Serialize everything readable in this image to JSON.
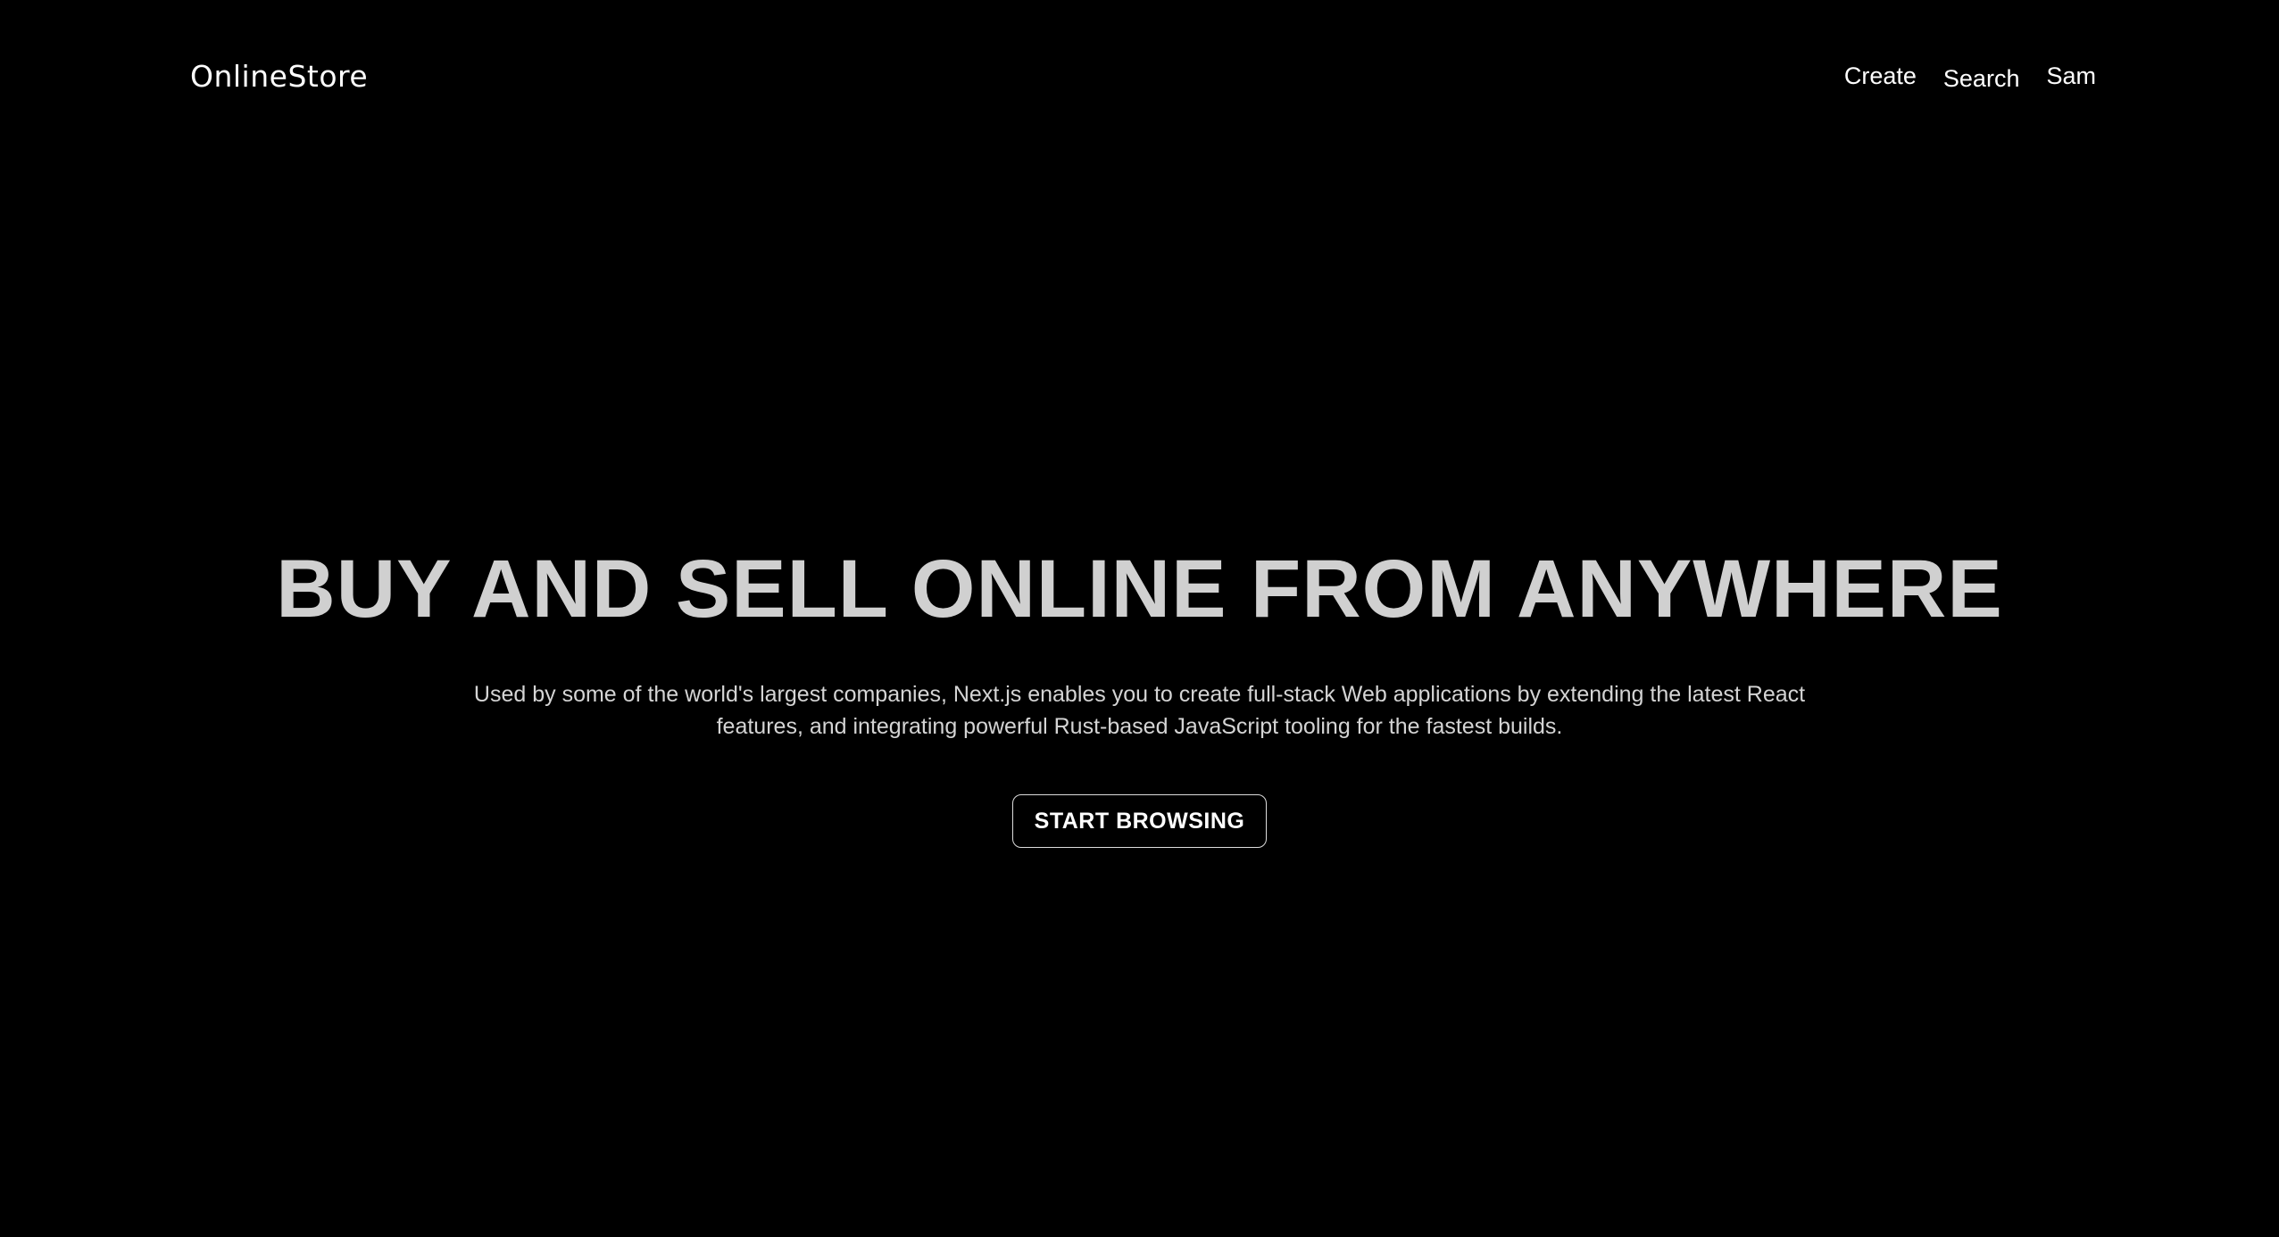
{
  "header": {
    "logo": "OnlineStore",
    "nav": [
      {
        "label": "Create"
      },
      {
        "label": "Search"
      },
      {
        "label": "Sam"
      }
    ]
  },
  "hero": {
    "title": "BUY AND SELL ONLINE FROM ANYWHERE",
    "subtitle": "Used by some of the world's largest companies, Next.js enables you to create full-stack Web applications by extending the latest React features, and integrating powerful Rust-based JavaScript tooling for the fastest builds.",
    "cta_label": "START BROWSING"
  },
  "colors": {
    "background": "#000000",
    "title": "#d0d0d0",
    "text": "#ffffff"
  }
}
